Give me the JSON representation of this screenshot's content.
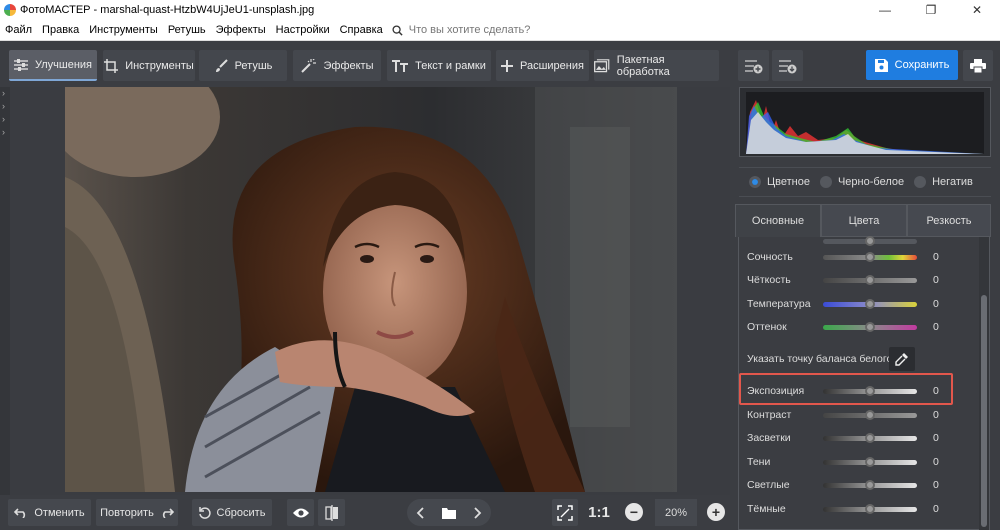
{
  "window": {
    "title": "ФотоМАСТЕР - marshal-quast-HtzbW4UjJeU1-unsplash.jpg",
    "minimize": "—",
    "restore": "❐",
    "close": "✕"
  },
  "menu": {
    "items": [
      "Файл",
      "Правка",
      "Инструменты",
      "Ретушь",
      "Эффекты",
      "Настройки",
      "Справка"
    ],
    "search_placeholder": "Что вы хотите сделать?"
  },
  "toolbar": {
    "tabs": [
      "Улучшения",
      "Инструменты",
      "Ретушь",
      "Эффекты",
      "Текст и рамки",
      "Расширения",
      "Пакетная обработка"
    ],
    "save_label": "Сохранить"
  },
  "bottom": {
    "undo": "Отменить",
    "redo": "Повторить",
    "reset": "Сбросить",
    "ratio": "1:1",
    "zoom": "20%"
  },
  "panel": {
    "modes": [
      "Цветное",
      "Черно-белое",
      "Негатив"
    ],
    "tabs": [
      "Основные",
      "Цвета",
      "Резкость"
    ],
    "white_balance_label": "Указать точку баланса белого",
    "sliders": [
      {
        "label": "Сочность",
        "value": "0"
      },
      {
        "label": "Чёткость",
        "value": "0"
      },
      {
        "label": "Температура",
        "value": "0"
      },
      {
        "label": "Оттенок",
        "value": "0"
      },
      {
        "label": "Экспозиция",
        "value": "0"
      },
      {
        "label": "Контраст",
        "value": "0"
      },
      {
        "label": "Засветки",
        "value": "0"
      },
      {
        "label": "Тени",
        "value": "0"
      },
      {
        "label": "Светлые",
        "value": "0"
      },
      {
        "label": "Тёмные",
        "value": "0"
      }
    ]
  }
}
